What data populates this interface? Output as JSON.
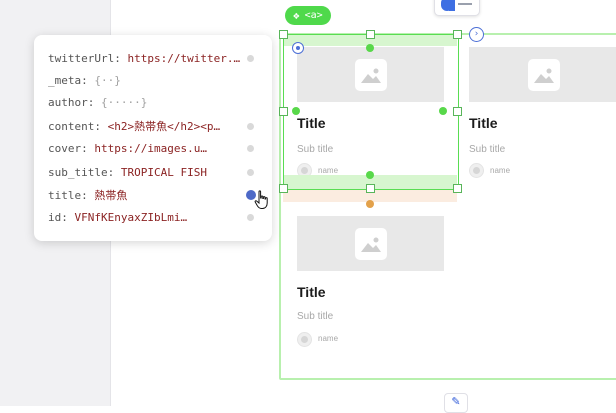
{
  "element_tag": {
    "label": "<a>",
    "icon": "component-diamond-icon"
  },
  "colors": {
    "selection": "#59dd52",
    "tag_chip": "#4fd94b",
    "accent_blue": "#3e6fe3",
    "value_text": "#8b2323"
  },
  "cards": [
    {
      "title": "Title",
      "subtitle": "Sub title",
      "name": "name"
    },
    {
      "title": "Title",
      "subtitle": "Sub title",
      "name": "name"
    },
    {
      "title": "Title",
      "subtitle": "Sub title",
      "name": "name"
    }
  ],
  "props_panel": {
    "rows": [
      {
        "key": "twitterUrl:",
        "value": "https://twitter.…",
        "kind": "string"
      },
      {
        "key": "_meta:",
        "value": "{··}",
        "kind": "object"
      },
      {
        "key": "author:",
        "value": "{·····}",
        "kind": "object"
      },
      {
        "key": "content:",
        "value": "<h2>熱帯魚</h2><p…",
        "kind": "string"
      },
      {
        "key": "cover:",
        "value": "https://images.u…",
        "kind": "string"
      },
      {
        "key": "sub_title:",
        "value": "TROPICAL FISH",
        "kind": "string"
      },
      {
        "key": "title:",
        "value": "熱帯魚",
        "kind": "string",
        "active": true
      },
      {
        "key": "id:",
        "value": "VFNfKEnyaxZIbLmi…",
        "kind": "string"
      }
    ]
  },
  "icons": {
    "top_toggle": "layout-toggle-icon",
    "target": "target-icon",
    "next": "chevron-right-circle-icon",
    "cursor": "hand-pointer-icon",
    "bottom": "edit-icon"
  }
}
